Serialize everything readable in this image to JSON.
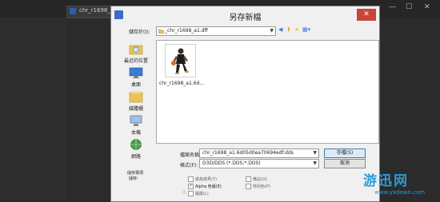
{
  "background": {
    "tab_title": "chr_r1698_a1.6d05d0ea70694edf.dds @ 100% (RGB/8)",
    "window_controls": [
      "—",
      "☐",
      "✕"
    ]
  },
  "dialog": {
    "title": "另存新檔",
    "close_label": "✕",
    "save_in_label": "儲存於(I):",
    "save_in_value": "_chr_r1698_a1.dff",
    "toolbar_icons": [
      "back-icon",
      "up-folder-icon",
      "new-folder-icon",
      "view-menu-icon"
    ],
    "places": [
      {
        "label": "最近的位置",
        "icon": "recent-places-icon"
      },
      {
        "label": "桌面",
        "icon": "desktop-icon"
      },
      {
        "label": "媒體櫃",
        "icon": "libraries-icon"
      },
      {
        "label": "本機",
        "icon": "computer-icon"
      },
      {
        "label": "網路",
        "icon": "network-icon"
      }
    ],
    "file": {
      "name": "chr_r1698_a1.6d..."
    },
    "filename_label": "檔案名稱(N):",
    "filename_value": "chr_r1698_a1.6d05d0ea70694edf.dds",
    "format_label": "格式(F):",
    "format_value": "D3D/DDS (*.DDS;*.DDS)",
    "save_button": "存檔(S)",
    "cancel_button": "取消",
    "options": {
      "title": "儲存選項",
      "save_label": "儲存:",
      "checkboxes": [
        {
          "label": "做為拷貝(Y)",
          "checked": false
        },
        {
          "label": "Alpha 色版(E)",
          "checked": true
        },
        {
          "label": "圖層(L)",
          "checked": false
        },
        {
          "label": "備註(O)",
          "checked": false
        },
        {
          "label": "特別色(P)",
          "checked": false
        }
      ]
    }
  },
  "watermark": {
    "main": "游迅网",
    "url": "www.yxdown.com"
  }
}
